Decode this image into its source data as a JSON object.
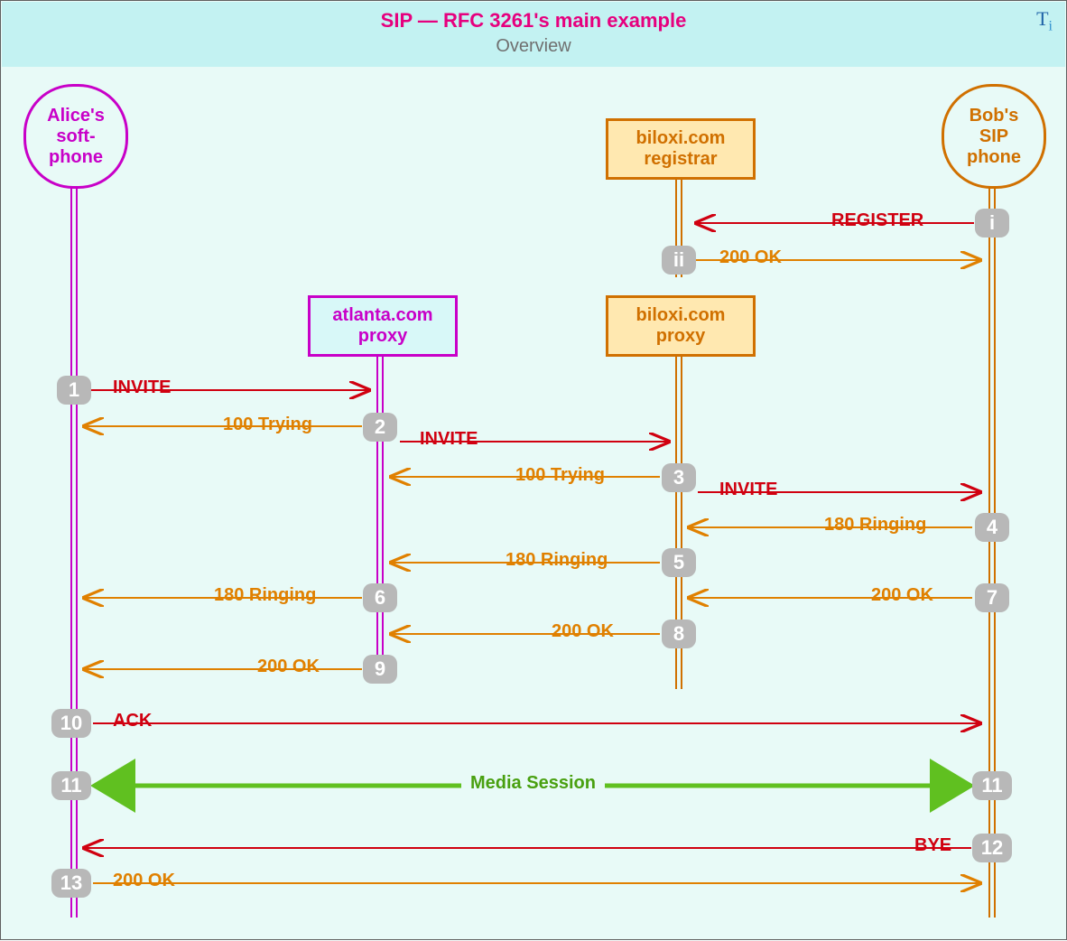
{
  "header": {
    "title": "SIP — RFC 3261's main example",
    "subtitle": "Overview",
    "logo_t": "T",
    "logo_i": "i"
  },
  "actors": {
    "alice": {
      "l1": "Alice's",
      "l2": "soft-",
      "l3": "phone"
    },
    "bob": {
      "l1": "Bob's",
      "l2": "SIP",
      "l3": "phone"
    },
    "registrar": {
      "l1": "biloxi.com",
      "l2": "registrar"
    },
    "atlanta": {
      "l1": "atlanta.com",
      "l2": "proxy"
    },
    "biloxi": {
      "l1": "biloxi.com",
      "l2": "proxy"
    }
  },
  "steps": {
    "i": "i",
    "ii": "ii",
    "1": "1",
    "2": "2",
    "3": "3",
    "4": "4",
    "5": "5",
    "6": "6",
    "7": "7",
    "8": "8",
    "9": "9",
    "10": "10",
    "11": "11",
    "12": "12",
    "13": "13"
  },
  "msg": {
    "register": "REGISTER",
    "ok": "200 OK",
    "invite": "INVITE",
    "trying": "100 Trying",
    "ringing": "180 Ringing",
    "ack": "ACK",
    "media": "Media Session",
    "bye": "BYE"
  },
  "colors": {
    "alice": "#c800c8",
    "bob": "#d07000",
    "reg": "#d07000",
    "req": "#d00010",
    "resp": "#e08000",
    "media": "#60c020"
  }
}
